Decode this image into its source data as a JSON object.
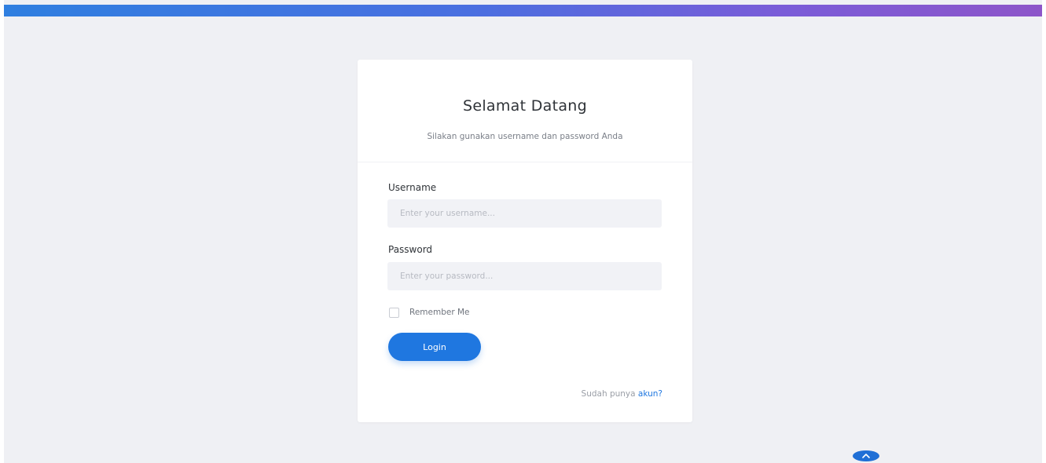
{
  "header": {
    "title": "Selamat Datang",
    "subtitle": "Silakan gunakan username dan password Anda"
  },
  "form": {
    "username_label": "Username",
    "username_placeholder": "Enter your username...",
    "password_label": "Password",
    "password_placeholder": "Enter your password...",
    "remember_label": "Remember Me",
    "remember_checked": false,
    "login_label": "Login"
  },
  "footer": {
    "prompt": "Sudah punya ",
    "link_text": "akun?"
  },
  "icons": {
    "scroll_top": "chevron-up-icon"
  },
  "colors": {
    "accent": "#1f77e0",
    "background": "#eff0f4",
    "topbar_start": "#2f7fe0",
    "topbar_end": "#8d55c9"
  }
}
